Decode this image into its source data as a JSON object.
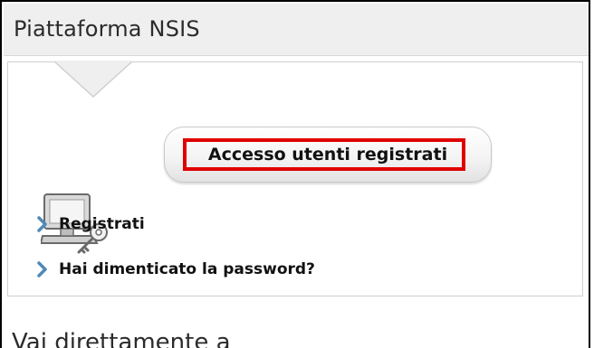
{
  "panel": {
    "title": "Piattaforma NSIS"
  },
  "login": {
    "button_label": "Accesso utenti registrati",
    "highlight_color": "#e00000",
    "icon": "computer-key-icon"
  },
  "links": [
    {
      "label": "Registrati",
      "icon": "chevron-right-icon"
    },
    {
      "label": "Hai dimenticato la password?",
      "icon": "chevron-right-icon"
    }
  ],
  "next_section": {
    "title": "Vai direttamente a"
  },
  "colors": {
    "chevron": "#4f89b8",
    "header_bg": "#efefef",
    "border": "#cfcfcf"
  }
}
